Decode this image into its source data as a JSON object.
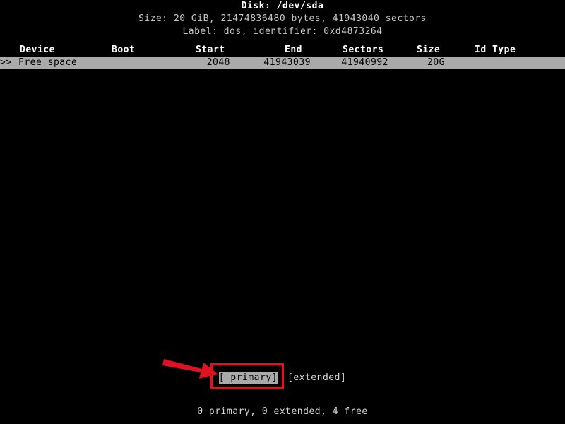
{
  "header": {
    "title": "Disk: /dev/sda",
    "size_line": "Size: 20 GiB, 21474836480 bytes, 41943040 sectors",
    "label_line": "Label: dos, identifier: 0xd4873264"
  },
  "table": {
    "columns": [
      "Device",
      "Boot",
      "Start",
      "End",
      "Sectors",
      "Size",
      "Id Type"
    ],
    "rows": [
      {
        "marker": ">>",
        "device": "Free space",
        "boot": "",
        "start": "2048",
        "end": "41943039",
        "sectors": "41940992",
        "size": "20G",
        "id_type": "",
        "selected": true
      }
    ]
  },
  "menu": {
    "items": [
      {
        "label": "[ primary]",
        "active": true
      },
      {
        "label": "[extended]",
        "active": false
      }
    ]
  },
  "status": {
    "summary": "0 primary, 0 extended, 4 free"
  },
  "annotation": {
    "arrow_name": "red-arrow-annotation",
    "box_name": "red-highlight-box",
    "color": "#e1111f"
  },
  "colors": {
    "background": "#000000",
    "foreground": "#d8d8d8",
    "bright": "#ffffff",
    "selection_bg": "#aaaaaa",
    "selection_fg": "#000000",
    "annotation_red": "#e1111f"
  }
}
